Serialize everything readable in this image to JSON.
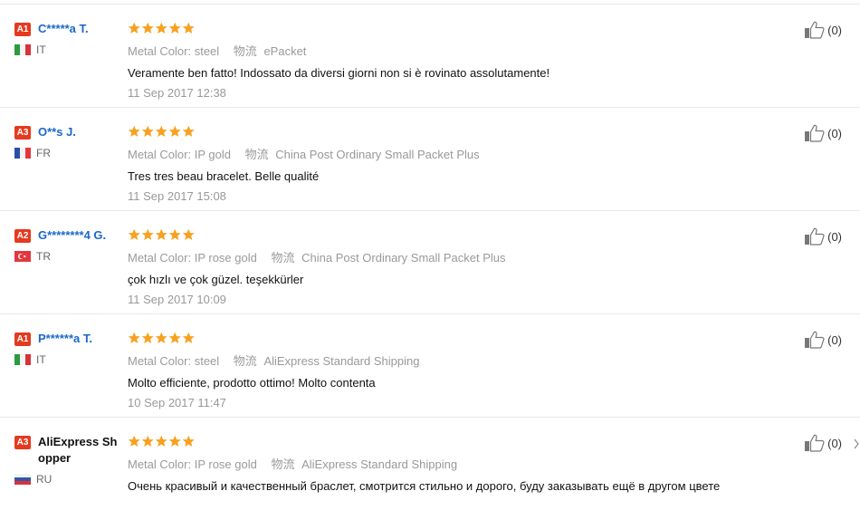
{
  "feedback": [
    {
      "level": "A1",
      "name": "C*****a T.",
      "country": "IT",
      "flag": "italy-flag",
      "rating": 5,
      "attr_label": "Metal Color:",
      "attr_value": "steel",
      "logistics_label": "物流",
      "logistics_value": "ePacket",
      "text": "Veramente ben fatto! Indossato da diversi giorni non si è rovinato assolutamente!",
      "date": "11 Sep 2017 12:38",
      "useful": "(0)"
    },
    {
      "level": "A3",
      "name": "O**s J.",
      "country": "FR",
      "flag": "france-flag",
      "rating": 5,
      "attr_label": "Metal Color:",
      "attr_value": "IP gold",
      "logistics_label": "物流",
      "logistics_value": "China Post Ordinary Small Packet Plus",
      "text": "Tres tres beau bracelet. Belle qualité",
      "date": "11 Sep 2017 15:08",
      "useful": "(0)"
    },
    {
      "level": "A2",
      "name": "G********4 G.",
      "country": "TR",
      "flag": "turkey-flag",
      "rating": 5,
      "attr_label": "Metal Color:",
      "attr_value": "IP rose gold",
      "logistics_label": "物流",
      "logistics_value": "China Post Ordinary Small Packet Plus",
      "text": "çok hızlı ve çok güzel. teşekkürler",
      "date": "11 Sep 2017 10:09",
      "useful": "(0)"
    },
    {
      "level": "A1",
      "name": "P******a T.",
      "country": "IT",
      "flag": "italy-flag",
      "rating": 5,
      "attr_label": "Metal Color:",
      "attr_value": "steel",
      "logistics_label": "物流",
      "logistics_value": "AliExpress Standard Shipping",
      "text": "Molto efficiente, prodotto ottimo! Molto contenta",
      "date": "10 Sep 2017 11:47",
      "useful": "(0)"
    },
    {
      "level": "A3",
      "name": "AliExpress Shopper",
      "country": "RU",
      "flag": "russia-flag",
      "rating": 5,
      "attr_label": "Metal Color:",
      "attr_value": "IP rose gold",
      "logistics_label": "物流",
      "logistics_value": "AliExpress Standard Shipping",
      "text": "Очень красивый и качественный браслет, смотрится стильно и дорого, буду заказывать ещё в другом цвете",
      "date": "",
      "useful": "(0)"
    }
  ],
  "colors": {
    "badge": "#e43a20",
    "user_link": "#1a68c9",
    "star": "#f7a120",
    "muted_text": "#999999"
  }
}
